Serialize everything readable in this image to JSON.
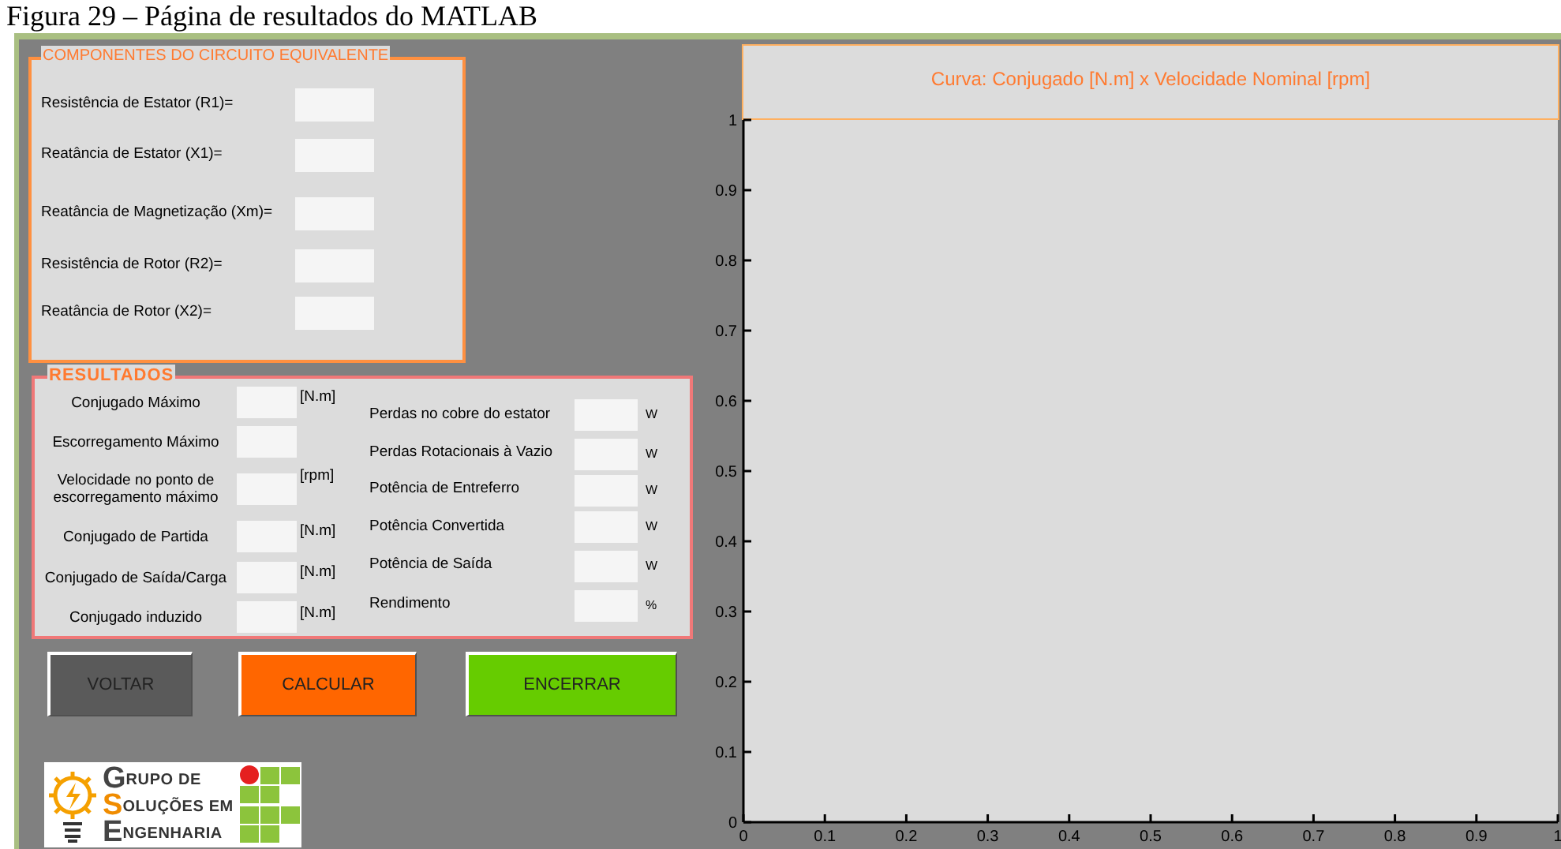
{
  "caption": "Figura 29 – Página de resultados do MATLAB",
  "components": {
    "title": "COMPONENTES DO CIRCUITO EQUIVALENTE",
    "fields": [
      {
        "label": "Resistência de Estator (R1)="
      },
      {
        "label": "Reatância de Estator (X1)="
      },
      {
        "label": "Reatância de Magnetização (Xm)="
      },
      {
        "label": "Resistência de Rotor (R2)="
      },
      {
        "label": "Reatância de Rotor (X2)="
      }
    ]
  },
  "results": {
    "title": "RESULTADOS",
    "left": [
      {
        "label": "Conjugado Máximo",
        "unit": "[N.m]"
      },
      {
        "label": "Escorregamento Máximo"
      },
      {
        "label": "Velocidade no ponto de escorregamento máximo",
        "unit": "[rpm]"
      },
      {
        "label": "Conjugado de Partida",
        "unit": "[N.m]"
      },
      {
        "label": "Conjugado de Saída/Carga",
        "unit": "[N.m]"
      },
      {
        "label": "Conjugado induzido",
        "unit": "[N.m]"
      }
    ],
    "right": [
      {
        "label": "Perdas no cobre do estator",
        "unit": "W"
      },
      {
        "label": "Perdas Rotacionais à Vazio",
        "unit": "W"
      },
      {
        "label": "Potência de Entreferro",
        "unit": "W"
      },
      {
        "label": "Potência Convertida",
        "unit": "W"
      },
      {
        "label": "Potência de Saída",
        "unit": "W"
      },
      {
        "label": "Rendimento",
        "unit": "%"
      }
    ]
  },
  "buttons": [
    {
      "label": "VOLTAR",
      "color": "#5a5a5a"
    },
    {
      "label": "CALCULAR",
      "color": "#ff6600"
    },
    {
      "label": "ENCERRAR",
      "color": "#66cc00"
    }
  ],
  "logo": {
    "lines": [
      {
        "initial": "G",
        "rest": "RUPO DE"
      },
      {
        "initial": "S",
        "rest": "OLUÇÕES EM"
      },
      {
        "initial": "E",
        "rest": "NGENHARIA"
      }
    ]
  },
  "chart_data": {
    "type": "line",
    "title": "Curva: Conjugado [N.m] x Velocidade Nominal [rpm]",
    "xlim": [
      0,
      1
    ],
    "ylim": [
      0,
      1
    ],
    "xticks": [
      0,
      0.1,
      0.2,
      0.3,
      0.4,
      0.5,
      0.6,
      0.7,
      0.8,
      0.9,
      1
    ],
    "yticks": [
      0,
      0.1,
      0.2,
      0.3,
      0.4,
      0.5,
      0.6,
      0.7,
      0.8,
      0.9,
      1
    ]
  }
}
